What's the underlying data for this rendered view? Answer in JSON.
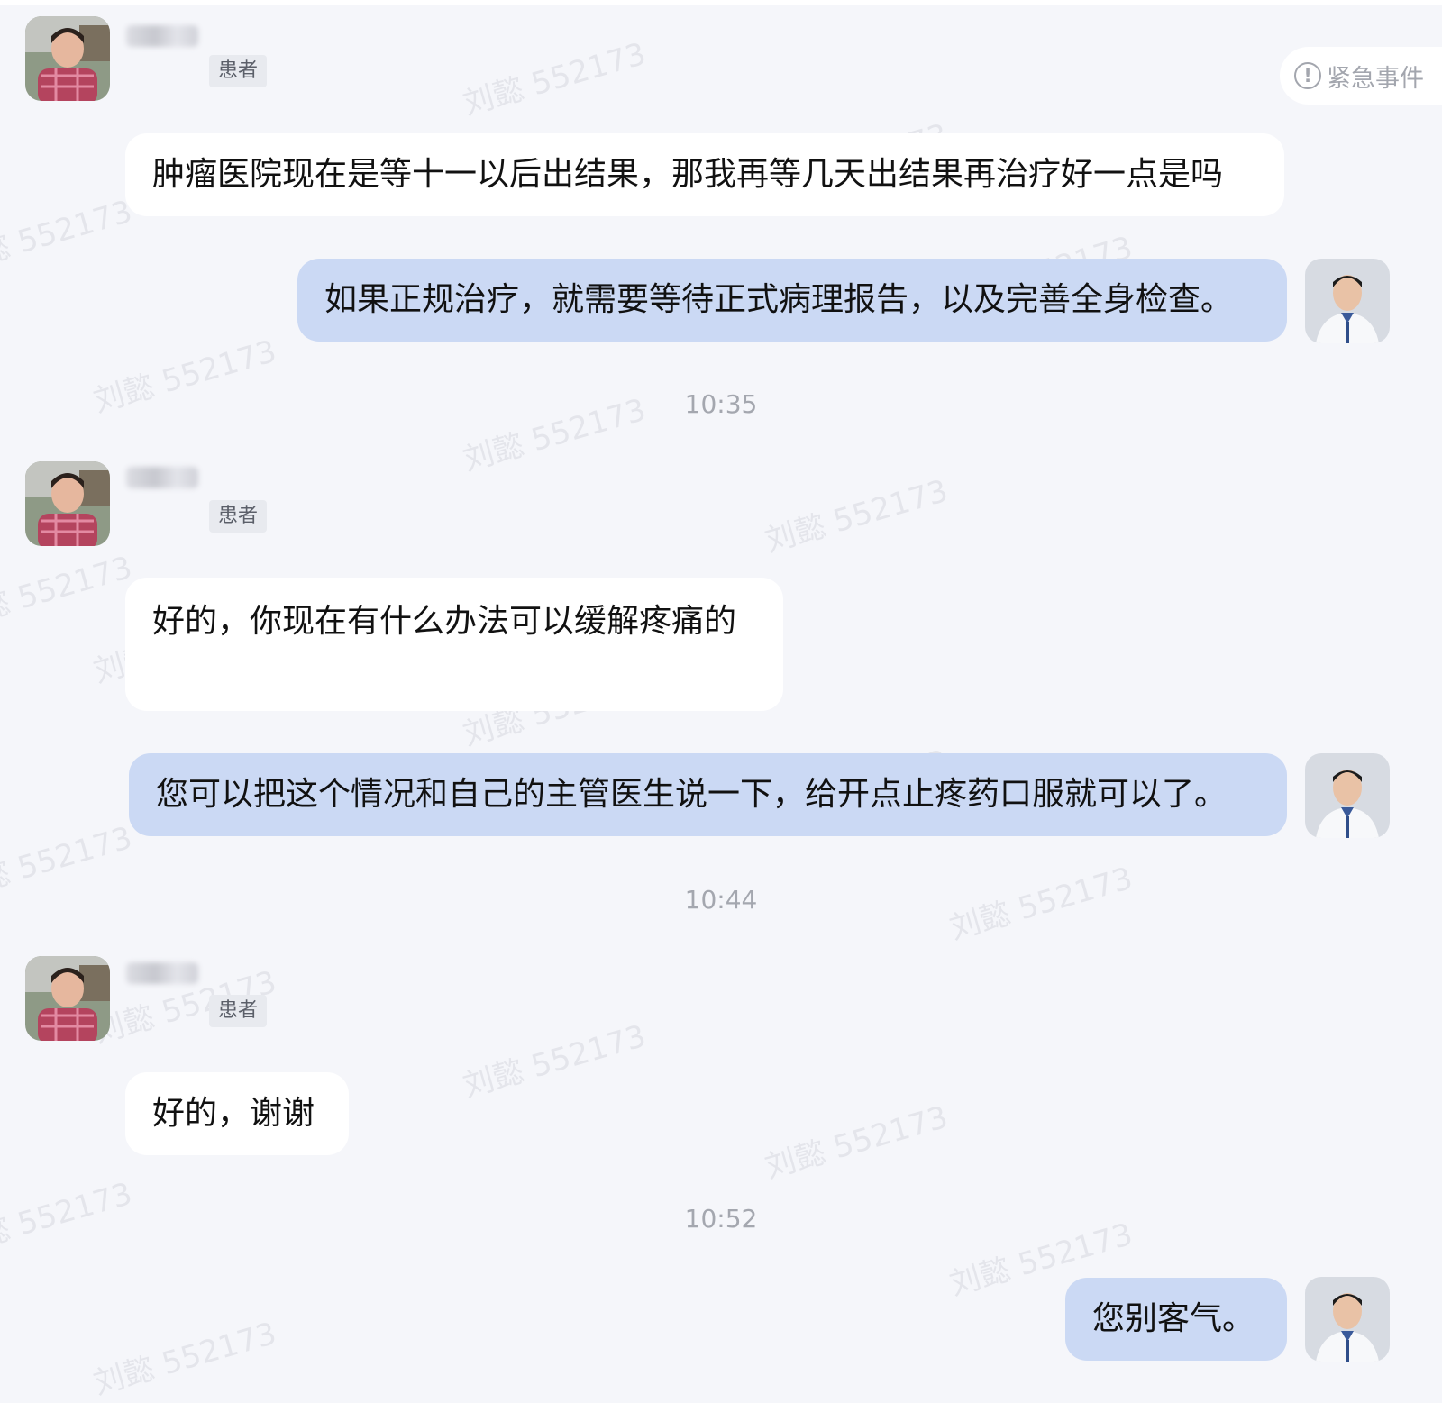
{
  "urgent_event": {
    "label": "紧急事件",
    "icon": "exclamation-circle-icon"
  },
  "watermark_text": "刘懿 552173",
  "messages": [
    {
      "sender": "patient",
      "role_tag": "患者",
      "text": "肿瘤医院现在是等十一以后出结果，那我再等几天出结果再治疗好一点是吗"
    },
    {
      "sender": "doctor",
      "text": "如果正规治疗，就需要等待正式病理报告，以及完善全身检查。"
    },
    {
      "time": "10:35"
    },
    {
      "sender": "patient",
      "role_tag": "患者",
      "text": "好的，你现在有什么办法可以缓解疼痛的"
    },
    {
      "sender": "doctor",
      "text": "您可以把这个情况和自己的主管医生说一下，给开点止疼药口服就可以了。"
    },
    {
      "time": "10:44"
    },
    {
      "sender": "patient",
      "role_tag": "患者",
      "text": "好的，谢谢"
    },
    {
      "time": "10:52"
    },
    {
      "sender": "doctor",
      "text": "您别客气。"
    }
  ],
  "colors": {
    "background": "#f5f6fa",
    "incoming_bubble": "#ffffff",
    "outgoing_bubble": "#cbd9f4",
    "timestamp": "#a4a7af"
  }
}
